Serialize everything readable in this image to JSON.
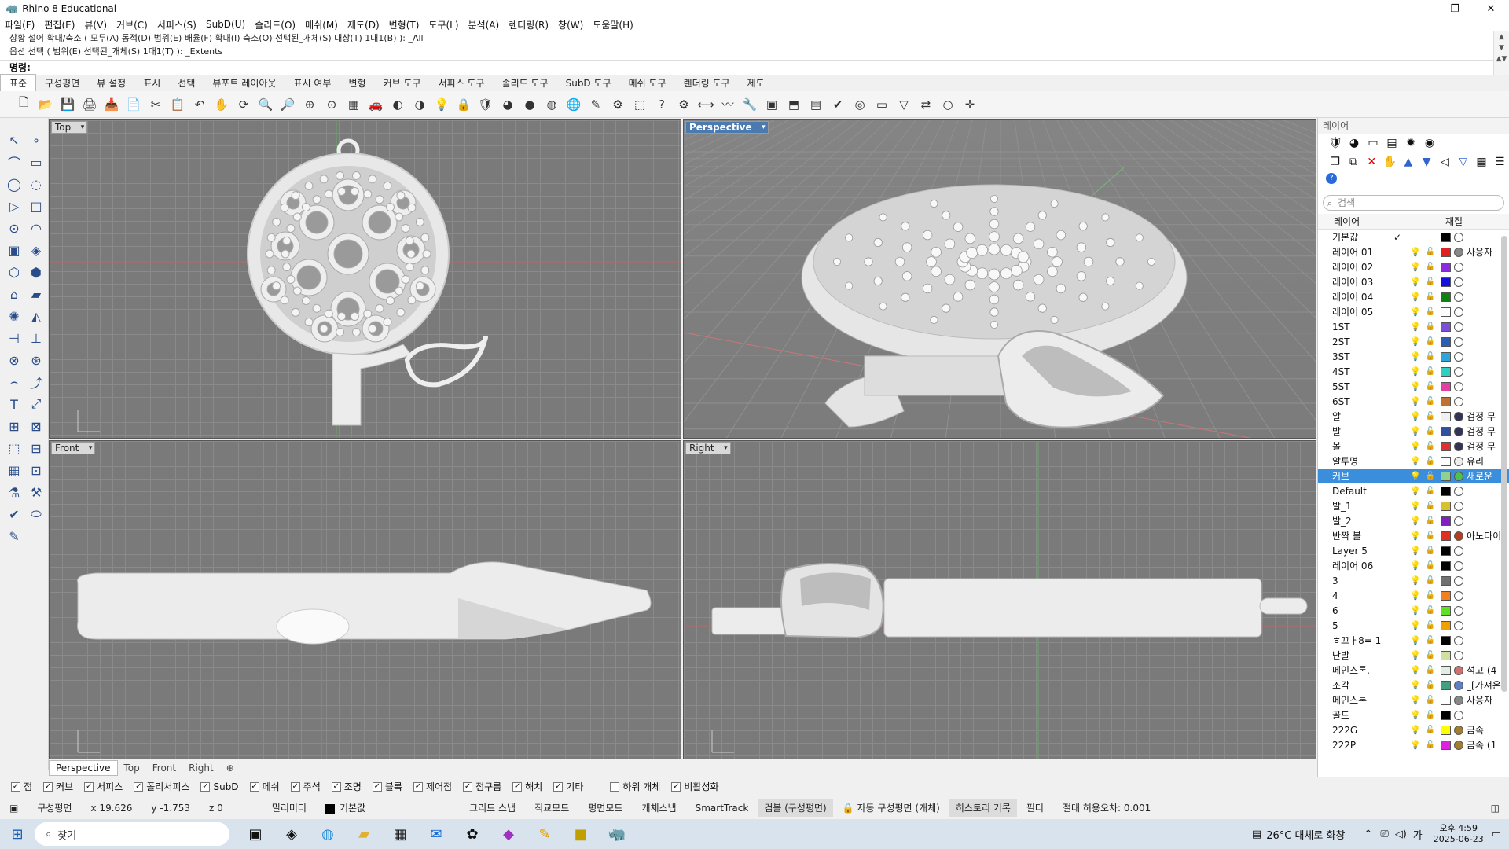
{
  "window": {
    "title": "Rhino 8 Educational",
    "minimize": "–",
    "maximize": "❐",
    "close": "✕"
  },
  "menu": [
    "파일(F)",
    "편집(E)",
    "뷰(V)",
    "커브(C)",
    "서피스(S)",
    "SubD(U)",
    "솔리드(O)",
    "메쉬(M)",
    "제도(D)",
    "변형(T)",
    "도구(L)",
    "분석(A)",
    "렌더링(R)",
    "창(W)",
    "도움말(H)"
  ],
  "command": {
    "history": [
      "상황 설어 확대/축소 ( 모두(A) 동적(D) 범위(E) 배율(F) 확대(I) 축소(O) 선택된_개체(S) 대상(T) 1대1(B) ): _All",
      "옵션 선택 ( 범위(E) 선택된_개체(S) 1대1(T) ): _Extents"
    ],
    "prompt": "명령:"
  },
  "tabs": [
    "표준",
    "구성평면",
    "뷰 설정",
    "표시",
    "선택",
    "뷰포트 레이아웃",
    "표시 여부",
    "변형",
    "커브 도구",
    "서피스 도구",
    "솔리드 도구",
    "SubD 도구",
    "메쉬 도구",
    "렌더링 도구",
    "제도"
  ],
  "toolbar_icons": [
    "new-icon",
    "open-icon",
    "save-icon",
    "print-icon",
    "import-icon",
    "copy-icon",
    "cut-icon",
    "paste-icon",
    "undo-icon",
    "pan-icon",
    "rotate-icon",
    "zoom-icon",
    "zoom-window-icon",
    "zoom-extents-icon",
    "zoom-selected-icon",
    "grid-icon",
    "car-icon",
    "shaded-icon",
    "render-icon",
    "light-icon",
    "lock-icon",
    "shield-icon",
    "color-icon",
    "sphere-icon",
    "material-icon",
    "globe-icon",
    "pen-icon",
    "gear-icon",
    "select-icon",
    "help-icon",
    "options-icon",
    "dim-icon",
    "curve-icon",
    "tools-icon",
    "group-icon",
    "block-icon",
    "layout-icon",
    "check-icon",
    "spiral-icon",
    "view-icon",
    "filter-icon",
    "arrows-icon",
    "bubble-icon",
    "snap-icon"
  ],
  "toolbar_glyphs": [
    "🗋",
    "📂",
    "💾",
    "🖨",
    "📥",
    "📄",
    "✂",
    "📋",
    "↶",
    "✋",
    "⟳",
    "🔍",
    "🔎",
    "⊕",
    "⊙",
    "▦",
    "🚗",
    "◐",
    "◑",
    "💡",
    "🔒",
    "🛡",
    "◕",
    "●",
    "◍",
    "🌐",
    "✎",
    "⚙",
    "⬚",
    "?",
    "⚙",
    "⟷",
    "〰",
    "🔧",
    "▣",
    "⬒",
    "▤",
    "✔",
    "◎",
    "▭",
    "▽",
    "⇄",
    "○",
    "✛"
  ],
  "left_tools": [
    "↖",
    "∘",
    "⌒",
    "▭",
    "◯",
    "◌",
    "▷",
    "□",
    "⊙",
    "◠",
    "▣",
    "◈",
    "⬡",
    "⬢",
    "⌂",
    "▰",
    "✺",
    "◭",
    "⊣",
    "⊥",
    "⊗",
    "⊛",
    "⌢",
    "⤴",
    "T",
    "⤢",
    "⊞",
    "⊠",
    "⬚",
    "⊟",
    "▦",
    "⊡",
    "⚗",
    "⚒",
    "✔",
    "⬭",
    "✎"
  ],
  "viewports": {
    "top": "Top",
    "perspective": "Perspective",
    "front": "Front",
    "right": "Right"
  },
  "viewport_tabs": [
    "Perspective",
    "Top",
    "Front",
    "Right",
    "⊕"
  ],
  "osnap": [
    {
      "label": "점",
      "checked": true
    },
    {
      "label": "커브",
      "checked": true
    },
    {
      "label": "서피스",
      "checked": true
    },
    {
      "label": "폴리서피스",
      "checked": true
    },
    {
      "label": "SubD",
      "checked": true
    },
    {
      "label": "메쉬",
      "checked": true
    },
    {
      "label": "주석",
      "checked": true
    },
    {
      "label": "조명",
      "checked": true
    },
    {
      "label": "블록",
      "checked": true
    },
    {
      "label": "제어점",
      "checked": true
    },
    {
      "label": "점구름",
      "checked": true
    },
    {
      "label": "해치",
      "checked": true
    },
    {
      "label": "기타",
      "checked": true
    },
    {
      "label": "하위 개체",
      "checked": false
    },
    {
      "label": "비활성화",
      "checked": true
    }
  ],
  "status": {
    "cplane": "구성평면",
    "x": "x 19.626",
    "y": "y -1.753",
    "z": "z 0",
    "units": "밀리미터",
    "layer": "기본값",
    "grid": "그리드 스냅",
    "ortho": "직교모드",
    "planar": "평면모드",
    "osnap": "개체스냅",
    "smarttrack": "SmartTrack",
    "gumball": "검볼 (구성평면)",
    "autocplane": "자동 구성평면 (개체)",
    "history": "히스토리 기록",
    "filter": "필터",
    "tolerance": "절대 허용오차: 0.001"
  },
  "layers": {
    "title": "레이어",
    "search_placeholder": "검색",
    "col_layer": "레이어",
    "col_material": "재질",
    "rows": [
      {
        "name": "기본값",
        "current": "✓",
        "color": "#000000",
        "mat": "",
        "matc": "#ffffff"
      },
      {
        "name": "레이어 01",
        "color": "#e02020",
        "mat": "사용자",
        "matc": "#888888"
      },
      {
        "name": "레이어 02",
        "color": "#8a2be2",
        "mat": "",
        "matc": "#ffffff"
      },
      {
        "name": "레이어 03",
        "color": "#1010e0",
        "mat": "",
        "matc": "#ffffff"
      },
      {
        "name": "레이어 04",
        "color": "#108010",
        "mat": "",
        "matc": "#ffffff"
      },
      {
        "name": "레이어 05",
        "color": "#ffffff",
        "mat": "",
        "matc": "#ffffff"
      },
      {
        "name": "1ST",
        "color": "#7b4fd6",
        "mat": "",
        "matc": "#ffffff"
      },
      {
        "name": "2ST",
        "color": "#2c5db0",
        "mat": "",
        "matc": "#ffffff"
      },
      {
        "name": "3ST",
        "color": "#2ea5d8",
        "mat": "",
        "matc": "#ffffff"
      },
      {
        "name": "4ST",
        "color": "#2fd0c0",
        "mat": "",
        "matc": "#ffffff"
      },
      {
        "name": "5ST",
        "color": "#e040a0",
        "mat": "",
        "matc": "#ffffff"
      },
      {
        "name": "6ST",
        "color": "#c07030",
        "mat": "",
        "matc": "#ffffff"
      },
      {
        "name": "알",
        "color": "#f0f0f0",
        "mat": "검정 무",
        "matc": "#333355"
      },
      {
        "name": "발",
        "color": "#3050a0",
        "mat": "검정 무",
        "matc": "#333355"
      },
      {
        "name": "볼",
        "color": "#e03030",
        "mat": "검정 무",
        "matc": "#333355"
      },
      {
        "name": "알투명",
        "color": "#ffffff",
        "mat": "유리",
        "matc": "#eeeeee"
      },
      {
        "name": "커브",
        "color": "#90d090",
        "mat": "새로운",
        "matc": "#50c050",
        "sel": true
      },
      {
        "name": "Default",
        "color": "#000000",
        "mat": "",
        "matc": "#ffffff"
      },
      {
        "name": "발_1",
        "color": "#d8c030",
        "mat": "",
        "matc": "#ffffff"
      },
      {
        "name": "발_2",
        "color": "#8020c0",
        "mat": "",
        "matc": "#ffffff"
      },
      {
        "name": "반짝 볼",
        "color": "#e03020",
        "mat": "아노다이",
        "matc": "#b04020"
      },
      {
        "name": "Layer 5",
        "color": "#000000",
        "mat": "",
        "matc": "#ffffff"
      },
      {
        "name": "레이어 06",
        "color": "#000000",
        "mat": "",
        "matc": "#ffffff"
      },
      {
        "name": "3",
        "color": "#707070",
        "mat": "",
        "matc": "#ffffff"
      },
      {
        "name": "4",
        "color": "#f08020",
        "mat": "",
        "matc": "#ffffff"
      },
      {
        "name": "6",
        "color": "#60e020",
        "mat": "",
        "matc": "#ffffff"
      },
      {
        "name": "5",
        "color": "#f0a000",
        "mat": "",
        "matc": "#ffffff"
      },
      {
        "name": "ㅎ끄ㅏ8= 1",
        "color": "#000000",
        "mat": "",
        "matc": "#ffffff"
      },
      {
        "name": "난발",
        "color": "#d0e0a0",
        "mat": "",
        "matc": "#ffffff"
      },
      {
        "name": "메인스톤.",
        "color": "#e0f0e0",
        "mat": "석고 (4",
        "matc": "#d07070"
      },
      {
        "name": "조각",
        "color": "#40a080",
        "mat": "_[가져온",
        "matc": "#6080c0"
      },
      {
        "name": "메인스톤",
        "color": "#ffffff",
        "mat": "사용자",
        "matc": "#888888"
      },
      {
        "name": "골드",
        "color": "#000000",
        "mat": "",
        "matc": "#ffffff"
      },
      {
        "name": "222G",
        "color": "#ffff00",
        "mat": "금속",
        "matc": "#a08030"
      },
      {
        "name": "222P",
        "color": "#e020e0",
        "mat": "금속 (1",
        "matc": "#a08030"
      }
    ]
  },
  "taskbar": {
    "search": "찾기",
    "weather": "26°C 대체로 화창",
    "time": "오후 4:59",
    "date": "2025-06-23",
    "lang": "가"
  }
}
